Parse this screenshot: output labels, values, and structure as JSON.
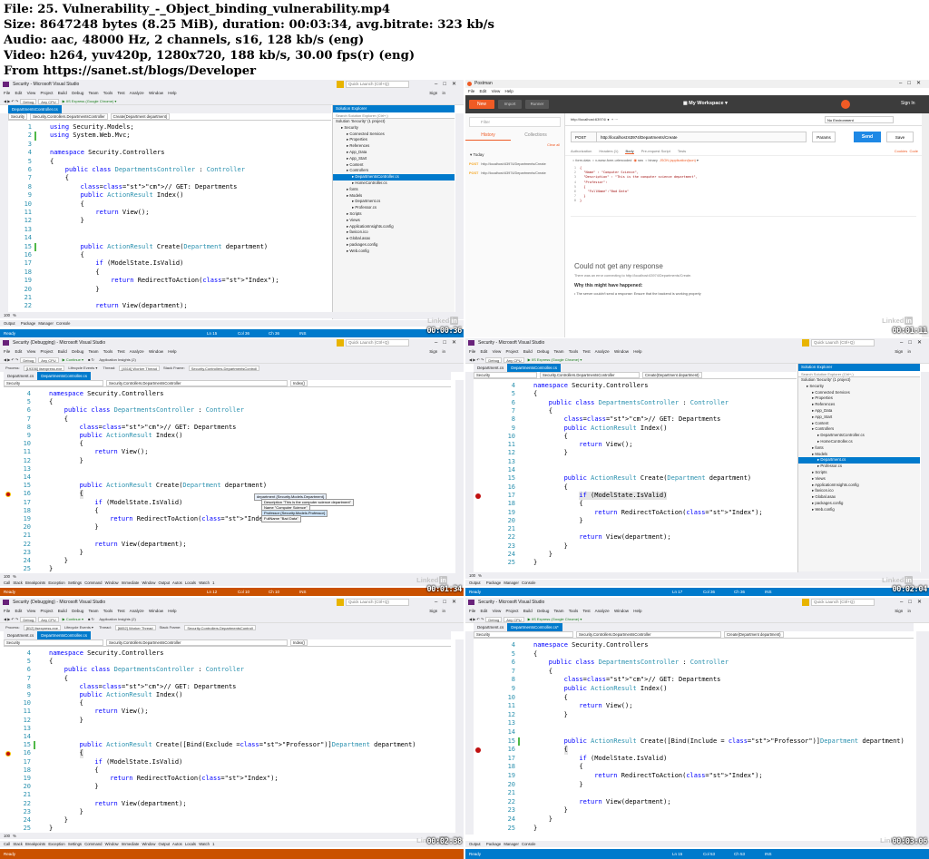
{
  "header": {
    "line1": "File: 25. Vulnerability_-_Object_binding_vulnerability.mp4",
    "line2": "Size: 8647248 bytes (8.25 MiB), duration: 00:03:34, avg.bitrate: 323 kb/s",
    "line3": "Audio: aac, 48000 Hz, 2 channels, s16, 128 kb/s (eng)",
    "line4": "Video: h264, yuv420p, 1280x720, 188 kb/s, 30.00 fps(r) (eng)",
    "line5": "From https://sanet.st/blogs/Developer"
  },
  "watermark": "Linked",
  "watermark_in": "in",
  "learning": "LEARNING",
  "timestamps": [
    "00:00:36",
    "00:01:11",
    "00:01:34",
    "00:02:04",
    "00:02:38",
    "00:03:06"
  ],
  "vs": {
    "title_normal": "Security - Microsoft Visual Studio",
    "title_debug": "Security (Debugging) - Microsoft Visual Studio",
    "quick_launch": "Quick Launch (Ctrl+Q)",
    "menu": [
      "File",
      "Edit",
      "View",
      "Project",
      "Build",
      "Debug",
      "Team",
      "Tools",
      "Test",
      "Analyze",
      "Window",
      "Help"
    ],
    "sign_in": "Sign in",
    "toolbar_debug": "Debug",
    "toolbar_cpu": "Any CPU",
    "toolbar_iis": "▶ IIS Express (Google Chrome) ▾",
    "toolbar_continue": "▶ Continue ▾",
    "toolbar_app_insights": "Application Insights (2)",
    "toolbar_process_label": "Process:",
    "process1": "[19336] iisexpress.exe",
    "process2": "[812] iisexpress.exe",
    "lifecycle": "Lifecycle Events ▾",
    "thread_label": "Thread:",
    "thread1": "[4516] Worker Thread",
    "thread2": "[6652] Worker Thread",
    "stack_frame_label": "Stack Frame:",
    "stack_frame": "Security.Controllers.DepartmentsControll",
    "tab_department_cs": "Department.cs",
    "tab_controller": "DepartmentsController.cs",
    "tab_controller_mod": "DepartmentsController.cs*",
    "nav_project": "Security",
    "nav_class": "Security.Controllers.DepartmentsController",
    "nav_method": "Create(Department department)",
    "nav_index": "Index()",
    "zoom": "100 %",
    "solution_explorer": {
      "title": "Solution Explorer",
      "search": "Search Solution Explorer (Ctrl+;)",
      "items": [
        "Solution 'Security' (1 project)",
        "Security",
        "Connected Services",
        "Properties",
        "References",
        "App_Data",
        "App_Start",
        "Content",
        "Controllers",
        "DepartmentsController.cs",
        "HomeController.cs",
        "fonts",
        "Models",
        "Department.cs",
        "Professor.cs",
        "Scripts",
        "Views",
        "ApplicationInsights.config",
        "favicon.ico",
        "Global.asax",
        "packages.config",
        "Web.config"
      ],
      "footer": [
        "Solution Explorer",
        "Team Explorer",
        "Notifications"
      ]
    },
    "bottom_tabs_normal": [
      "Output",
      "Package Manager Console"
    ],
    "bottom_tabs_debug": [
      "Call Stack",
      "Breakpoints",
      "Exception Settings",
      "Command Window",
      "Immediate Window",
      "Output",
      "Autos",
      "Locals",
      "Watch 1"
    ],
    "status_ready": "Ready",
    "status_p1": [
      "Ln 15",
      "Col 36",
      "Ch 36",
      "INS"
    ],
    "status_p3": [
      "Ln 12",
      "Col 10",
      "Ch 10",
      "INS"
    ],
    "status_p4": [
      "Ln 17",
      "Col 36",
      "Ch 36",
      "INS"
    ],
    "status_p6": [
      "Ln 15",
      "Col 53",
      "Ch 53",
      "INS"
    ],
    "side_tabs_left": [
      "Server Explorer",
      "Toolbox"
    ],
    "side_tabs_right": [
      "Diagnostic Tools",
      "Properties",
      "Solution Explorer",
      "Team Explorer",
      "Notifications"
    ]
  },
  "code": {
    "using1": "using Security.Models;",
    "using2": "using System.Web.Mvc;",
    "ns": "namespace Security.Controllers",
    "class": "public class DepartmentsController : Controller",
    "comment": "// GET: Departments",
    "index": "public ActionResult Index()",
    "return_view": "return View();",
    "create": "public ActionResult Create(Department department)",
    "create_exclude": "public ActionResult Create([Bind(Exclude =\"Professor\")]Department department)",
    "create_include": "public ActionResult Create([Bind(Include = \"Professor\")]Department department)",
    "if": "if (ModelState.IsValid)",
    "redirect": "return RedirectToAction(\"Index\");",
    "return_view_dept": "return View(department);",
    "open": "{",
    "close": "}"
  },
  "debug_tip": {
    "root": "department  {Security.Models.Department}",
    "description": "Description  \"This is the computer science department\"",
    "name": "Name  \"Computer Science\"",
    "professor": "Professor  {Security.Models.Professor}",
    "fullname": "FullName  \"Bad Data\""
  },
  "postman": {
    "title": "Postman",
    "menu": [
      "File",
      "Edit",
      "View",
      "Help"
    ],
    "new": "New",
    "import": "Import",
    "runner": "Runner",
    "workspace": "My Workspace",
    "sign_in": "Sign In",
    "filter": "Filter",
    "history": "History",
    "collections": "Collections",
    "clear_all": "Clear all",
    "today": "Today",
    "history_items": [
      "http://localhost:63974/Departments/Create",
      "http://localhost:63974/Departments/Create"
    ],
    "method_tag": "POST",
    "tab_url": "http://localhost:63974/",
    "env": "No Environment",
    "method": "POST",
    "url": "http://localhost:63974/Departments/Create",
    "params": "Params",
    "send": "Send",
    "save": "Save",
    "req_tabs": [
      "Authorization",
      "Headers (1)",
      "Body",
      "Pre-request Script",
      "Tests"
    ],
    "cookies": "Cookies",
    "code_link": "Code",
    "body_types": [
      "form-data",
      "x-www-form-urlencoded",
      "raw",
      "binary",
      "JSON (application/json)"
    ],
    "body_lines": [
      "{",
      "  \"Name\" : \"Computer Science\",",
      "  \"Description\" : \"This is the computer science department\",",
      "  \"Professor\":",
      "  {",
      "    \"FullName\":\"Bad Data\"",
      "  }",
      "}"
    ],
    "error_title": "Could not get any response",
    "error_text": "There was an error connecting to http://localhost:63974/Departments/Create.",
    "why": "Why this might have happened:",
    "reason": "The server couldn't send a response: Ensure that the backend is working properly"
  },
  "colors": {
    "vs_blue": "#007acc",
    "vs_orange": "#ca5100",
    "postman_orange": "#ef5b25",
    "send_blue": "#1e88e5"
  }
}
